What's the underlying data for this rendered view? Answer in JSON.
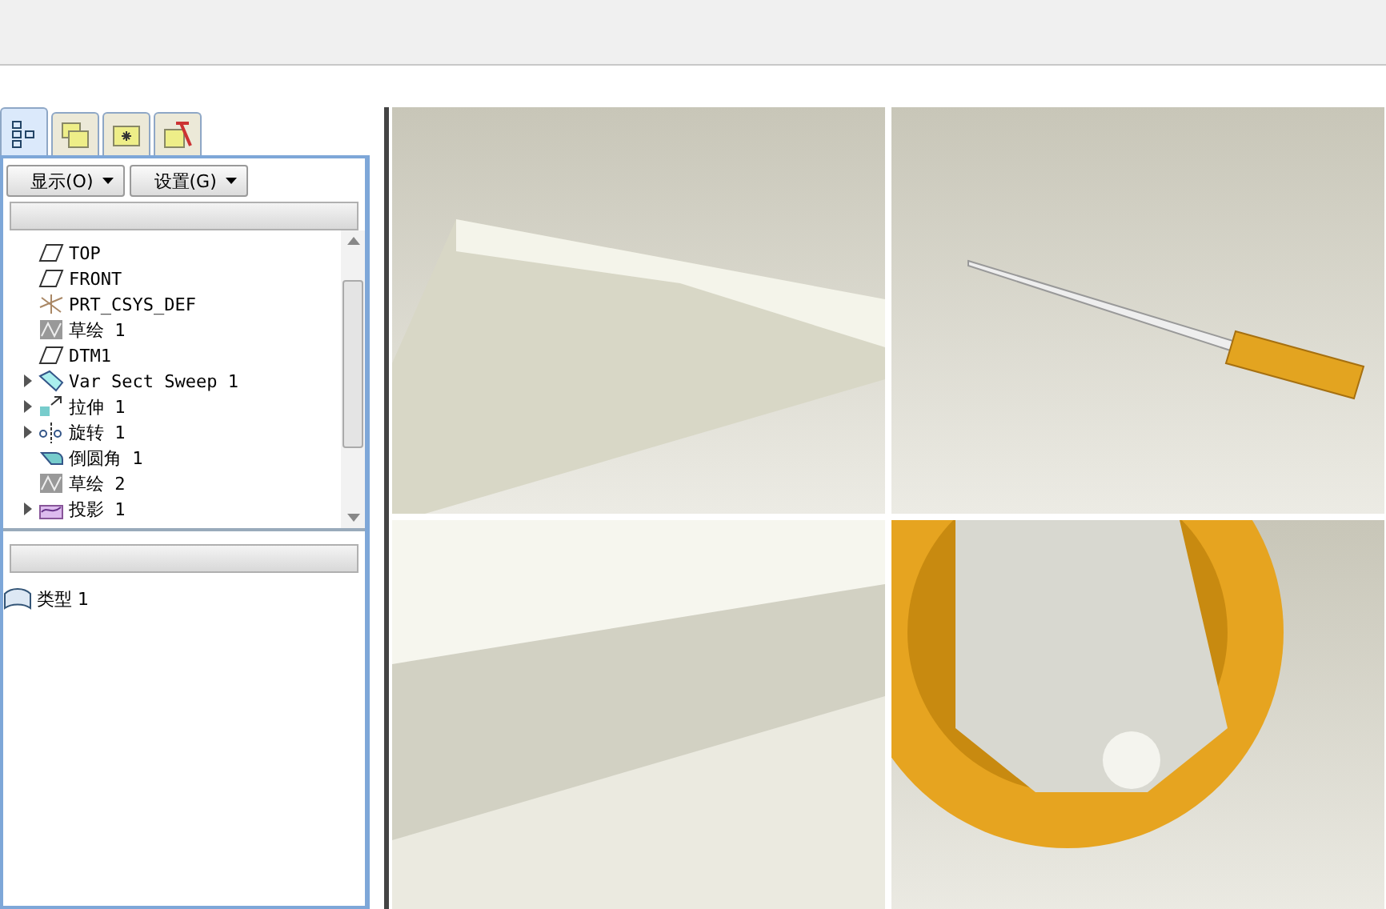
{
  "model_tree": {
    "tabs": [
      {
        "kind": "tree",
        "selected": true
      },
      {
        "kind": "folders",
        "selected": false
      },
      {
        "kind": "favorites",
        "selected": false
      },
      {
        "kind": "tools",
        "selected": false
      }
    ],
    "buttons": [
      "显示(O)",
      "设置(G)"
    ],
    "items": [
      {
        "label": "TOP",
        "kind": "plane",
        "expandable": false
      },
      {
        "label": "FRONT",
        "kind": "plane",
        "expandable": false
      },
      {
        "label": "PRT_CSYS_DEF",
        "kind": "csys",
        "expandable": false
      },
      {
        "label": "草绘 1",
        "kind": "sketch",
        "expandable": false
      },
      {
        "label": "DTM1",
        "kind": "plane",
        "expandable": false
      },
      {
        "label": "Var Sect Sweep 1",
        "kind": "sweep",
        "expandable": true
      },
      {
        "label": "拉伸 1",
        "kind": "extrude",
        "expandable": true
      },
      {
        "label": "旋转 1",
        "kind": "revolve",
        "expandable": true
      },
      {
        "label": "倒圆角 1",
        "kind": "round",
        "expandable": false
      },
      {
        "label": "草绘 2",
        "kind": "sketch",
        "expandable": false
      },
      {
        "label": "投影 1",
        "kind": "project",
        "expandable": true
      }
    ],
    "layer_items": [
      {
        "label": "类型 1"
      }
    ]
  }
}
